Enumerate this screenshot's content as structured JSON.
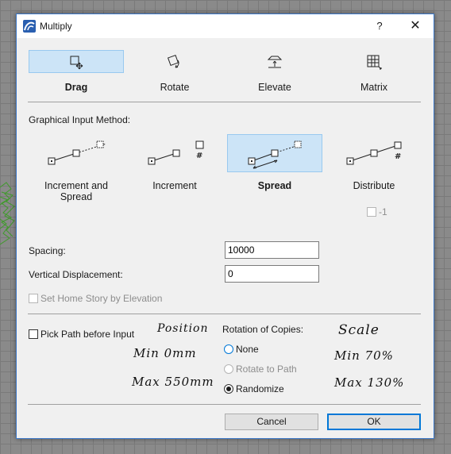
{
  "window": {
    "title": "Multiply"
  },
  "titlebar": {
    "help_glyph": "?",
    "close_glyph": "✕"
  },
  "modes": [
    {
      "label": "Drag",
      "icon": "drag-icon",
      "selected": true
    },
    {
      "label": "Rotate",
      "icon": "rotate-icon",
      "selected": false
    },
    {
      "label": "Elevate",
      "icon": "elevate-icon",
      "selected": false
    },
    {
      "label": "Matrix",
      "icon": "matrix-icon",
      "selected": false
    }
  ],
  "input_method": {
    "heading": "Graphical Input Method:",
    "options": [
      {
        "label": "Increment and Spread",
        "icon": "increment-and-spread-icon",
        "selected": false
      },
      {
        "label": "Increment",
        "icon": "increment-icon",
        "selected": false
      },
      {
        "label": "Spread",
        "icon": "spread-icon",
        "selected": true
      },
      {
        "label": "Distribute",
        "icon": "distribute-icon",
        "selected": false
      }
    ],
    "distribute_minus_one": {
      "label": "-1",
      "checked": false,
      "enabled": false
    }
  },
  "fields": {
    "spacing": {
      "label": "Spacing:",
      "value": "10000"
    },
    "vertical_displacement": {
      "label": "Vertical Displacement:",
      "value": "0"
    }
  },
  "set_home_story": {
    "label": "Set Home Story by Elevation",
    "checked": false,
    "enabled": false
  },
  "pick_path": {
    "label": "Pick Path before Input",
    "checked": false
  },
  "rotation": {
    "heading": "Rotation of Copies:",
    "options": [
      {
        "label": "None",
        "checked": false,
        "enabled": true
      },
      {
        "label": "Rotate to Path",
        "checked": false,
        "enabled": false
      },
      {
        "label": "Randomize",
        "checked": true,
        "enabled": true
      }
    ]
  },
  "annotations": {
    "position_title": "Position",
    "position_min": "Min  0mm",
    "position_max": "Max  550mm",
    "scale_title": "Scale",
    "scale_min": "Min  70%",
    "scale_max": "Max  130%"
  },
  "buttons": {
    "cancel": "Cancel",
    "ok": "OK"
  },
  "colors": {
    "selection": "#cce4f7",
    "selection_border": "#99c9ef",
    "accent": "#0078d7",
    "plant": "#3f9a2b"
  }
}
